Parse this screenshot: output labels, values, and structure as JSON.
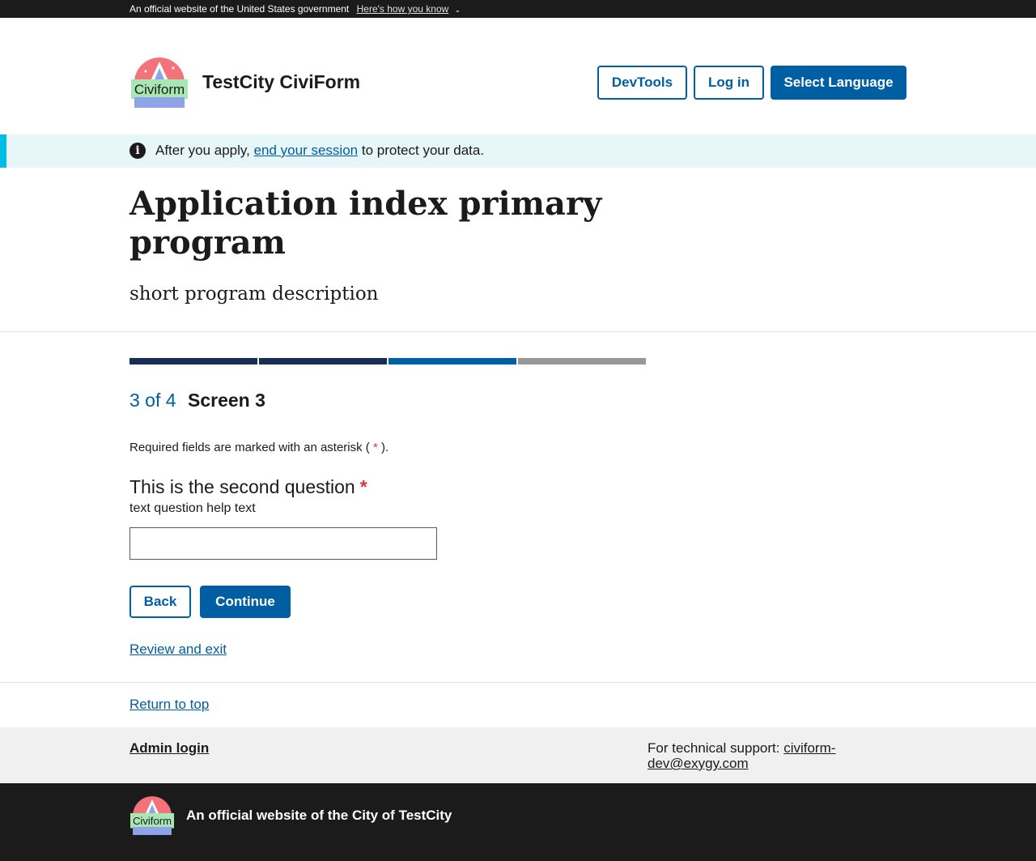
{
  "gov_banner": {
    "text": "An official website of the United States government",
    "link": "Here's how you know"
  },
  "header": {
    "logo_text": "Civiform",
    "site_title": "TestCity CiviForm",
    "buttons": {
      "devtools": "DevTools",
      "login": "Log in",
      "language": "Select Language"
    }
  },
  "alert": {
    "prefix": "After you apply,",
    "link": "end your session",
    "suffix": "to protect your data."
  },
  "program": {
    "title": "Application index primary program",
    "description": "short program description"
  },
  "progress": {
    "current": 3,
    "total": 4,
    "segment_colors": [
      "#162e51",
      "#162e51",
      "#005ea2",
      "#979797"
    ]
  },
  "screen": {
    "step_label": "3 of 4",
    "name": "Screen 3",
    "required_note_prefix": "Required fields are marked with an asterisk (",
    "required_note_asterisk": "*",
    "required_note_suffix": ")."
  },
  "question": {
    "label": "This is the second question",
    "asterisk": "*",
    "help": "text question help text",
    "value": ""
  },
  "actions": {
    "back": "Back",
    "continue": "Continue",
    "review_exit": "Review and exit",
    "return_top": "Return to top"
  },
  "footer": {
    "admin_login": "Admin login",
    "support_label": "For technical support:",
    "support_email": "civiform-dev@exygy.com",
    "official_text": "An official website of the City of TestCity",
    "logo_text": "Civiform"
  },
  "colors": {
    "primary": "#005ea2",
    "alert_bg": "#e7f6f8",
    "alert_border": "#00bde3",
    "required": "#d83933"
  }
}
